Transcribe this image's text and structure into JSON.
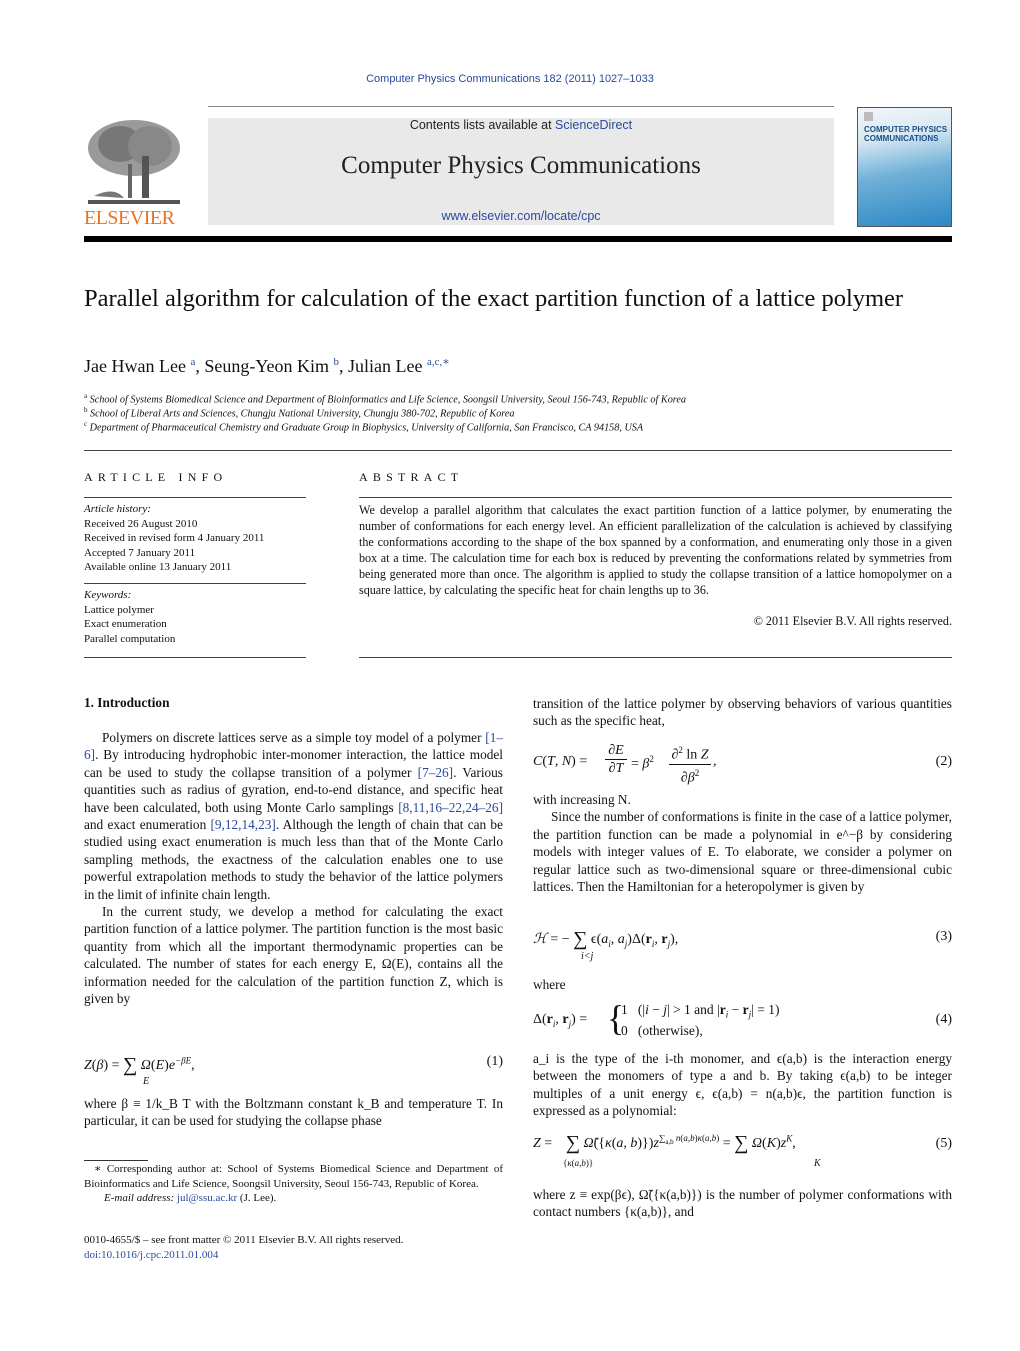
{
  "header": {
    "citation": "Computer Physics Communications 182 (2011) 1027–1033",
    "contents_prefix": "Contents lists available at ",
    "contents_link": "ScienceDirect",
    "journal_name": "Computer Physics Communications",
    "journal_url": "www.elsevier.com/locate/cpc",
    "publisher_logo_text": "ELSEVIER",
    "cover_title_line1": "COMPUTER PHYSICS",
    "cover_title_line2": "COMMUNICATIONS",
    "brand_color": "#e8731f",
    "link_color": "#2a4a9a"
  },
  "article": {
    "title": "Parallel algorithm for calculation of the exact partition function of a lattice polymer",
    "authors": [
      {
        "name": "Jae Hwan Lee",
        "sup": "a"
      },
      {
        "name": "Seung-Yeon Kim",
        "sup": "b"
      },
      {
        "name": "Julian Lee",
        "sup": "a,c,∗"
      }
    ],
    "affiliations": [
      {
        "key": "a",
        "text": "School of Systems Biomedical Science and Department of Bioinformatics and Life Science, Soongsil University, Seoul 156-743, Republic of Korea"
      },
      {
        "key": "b",
        "text": "School of Liberal Arts and Sciences, Chungju National University, Chungju 380-702, Republic of Korea"
      },
      {
        "key": "c",
        "text": "Department of Pharmaceutical Chemistry and Graduate Group in Biophysics, University of California, San Francisco, CA 94158, USA"
      }
    ]
  },
  "article_info": {
    "heading": "ARTICLE INFO",
    "history_label": "Article history:",
    "history": [
      "Received 26 August 2010",
      "Received in revised form 4 January 2011",
      "Accepted 7 January 2011",
      "Available online 13 January 2011"
    ],
    "keywords_label": "Keywords:",
    "keywords": [
      "Lattice polymer",
      "Exact enumeration",
      "Parallel computation"
    ]
  },
  "abstract": {
    "heading": "ABSTRACT",
    "text": "We develop a parallel algorithm that calculates the exact partition function of a lattice polymer, by enumerating the number of conformations for each energy level. An efficient parallelization of the calculation is achieved by classifying the conformations according to the shape of the box spanned by a conformation, and enumerating only those in a given box at a time. The calculation time for each box is reduced by preventing the conformations related by symmetries from being generated more than once. The algorithm is applied to study the collapse transition of a lattice homopolymer on a square lattice, by calculating the specific heat for chain lengths up to 36.",
    "copyright": "© 2011 Elsevier B.V. All rights reserved."
  },
  "body": {
    "section1_title": "1. Introduction",
    "left": {
      "p1_a": "Polymers on discrete lattices serve as a simple toy model of a polymer ",
      "ref1": "[1–6]",
      "p1_b": ". By introducing hydrophobic inter-monomer interaction, the lattice model can be used to study the collapse transition of a polymer ",
      "ref2": "[7–26]",
      "p1_c": ". Various quantities such as radius of gyration, end-to-end distance, and specific heat have been calculated, both using Monte Carlo samplings ",
      "ref3": "[8,11,16–22,24–26]",
      "p1_d": " and exact enumeration ",
      "ref4": "[9,12,14,23]",
      "p1_e": ". Although the length of chain that can be studied using exact enumeration is much less than that of the Monte Carlo sampling methods, the exactness of the calculation enables one to use powerful extrapolation methods to study the behavior of the lattice polymers in the limit of infinite chain length.",
      "p2": "In the current study, we develop a method for calculating the exact partition function of a lattice polymer. The partition function is the most basic quantity from which all the important thermodynamic properties can be calculated. The number of states for each energy E, Ω(E), contains all the information needed for the calculation of the partition function Z, which is given by",
      "eq1": "Z(β) = Σ_E Ω(E) e^(−βE),",
      "eq1_num": "(1)",
      "p3": "where β ≡ 1/k_B T with the Boltzmann constant k_B and temperature T. In particular, it can be used for studying the collapse phase"
    },
    "right": {
      "p1": "transition of the lattice polymer by observing behaviors of various quantities such as the specific heat,",
      "eq2_num": "(2)",
      "p2": "with increasing N.",
      "p3": "Since the number of conformations is finite in the case of a lattice polymer, the partition function can be made a polynomial in e^−β by considering models with integer values of E. To elaborate, we consider a polymer on regular lattice such as two-dimensional square or three-dimensional cubic lattices. Then the Hamiltonian for a heteropolymer is given by",
      "eq3_num": "(3)",
      "where": "where",
      "eq4_num": "(4)",
      "p4": "a_i is the type of the i-th monomer, and ϵ(a,b) is the interaction energy between the monomers of type a and b. By taking ϵ(a,b) to be integer multiples of a unit energy ϵ, ϵ(a,b) = n(a,b)ϵ, the partition function is expressed as a polynomial:",
      "eq5_num": "(5)",
      "p5": "where z ≡ exp(βϵ), Ω̃({κ(a,b)}) is the number of polymer conformations with contact numbers {κ(a,b)}, and"
    }
  },
  "footnotes": {
    "corresponding": "Corresponding author at: School of Systems Biomedical Science and Department of Bioinformatics and Life Science, Soongsil University, Seoul 156-743, Republic of Korea.",
    "email_label": "E-mail address:",
    "email": "jul@ssu.ac.kr",
    "email_suffix": "(J. Lee).",
    "issn_line": "0010-4655/$ – see front matter  © 2011 Elsevier B.V. All rights reserved.",
    "doi": "doi:10.1016/j.cpc.2011.01.004"
  }
}
